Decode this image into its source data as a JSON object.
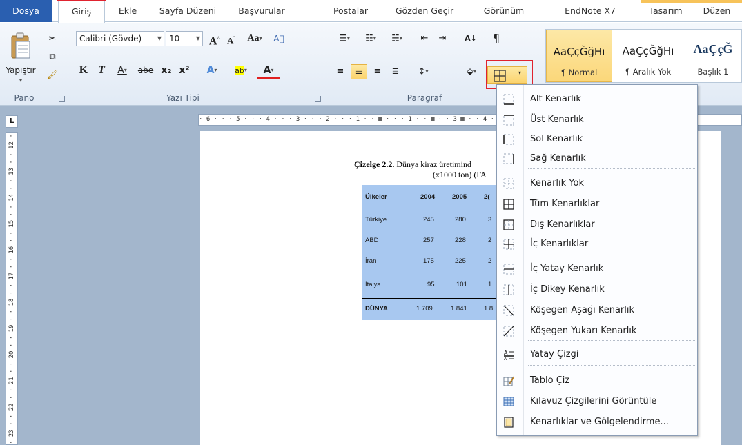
{
  "tabs": [
    {
      "id": "file",
      "label": "Dosya"
    },
    {
      "id": "home",
      "label": "Giriş"
    },
    {
      "id": "insert",
      "label": "Ekle"
    },
    {
      "id": "page-layout",
      "label": "Sayfa Düzeni"
    },
    {
      "id": "references",
      "label": "Başvurular"
    },
    {
      "id": "mailings",
      "label": "Postalar"
    },
    {
      "id": "review",
      "label": "Gözden Geçir"
    },
    {
      "id": "view",
      "label": "Görünüm"
    },
    {
      "id": "endnote",
      "label": "EndNote X7"
    },
    {
      "id": "design",
      "label": "Tasarım"
    },
    {
      "id": "layout",
      "label": "Düzen"
    }
  ],
  "ribbon": {
    "clipboard": {
      "paste": "Yapıştır",
      "label": "Pano"
    },
    "font": {
      "label": "Yazı Tipi",
      "family": "Calibri (Gövde)",
      "size": "10",
      "bold": "K",
      "italic": "T",
      "underline": "A",
      "strike": "abe",
      "sub": "x₂",
      "sup": "x²",
      "grow": "A",
      "shrink": "A",
      "case": "Aa",
      "color": "A"
    },
    "paragraph": {
      "label": "Paragraf",
      "pilcrow": "¶",
      "sort": "A↓"
    },
    "styles": {
      "items": [
        {
          "sample": "AaÇçĞğHı",
          "name": "¶ Normal"
        },
        {
          "sample": "AaÇçĞğHı",
          "name": "¶ Aralık Yok"
        },
        {
          "sample": "AaÇçĞ",
          "name": "Başlık 1"
        }
      ]
    }
  },
  "rulers": {
    "corner": "L",
    "horizontal": "· 6 · · · 5 · · · 4 · · · 3 · · · 2 · · · 1 · · ▦ · · · 1 · · ▦ · · 3 ▦ · · 4 · ▦ 5                                                   · 14 ·",
    "vertical": "· 23 · · 22 · · 21 · · 20 · · 19 · · 18 · · 17 · · 16 · · 15 · · 14 · · 13 · · 12 ·"
  },
  "document": {
    "caption_bold": "Çizelge 2.2.",
    "caption_text": " Dünya kiraz üretimind",
    "caption_line2": "(x1000 ton) (FA",
    "table": {
      "header": [
        "Ülkeler",
        "2004",
        "2005",
        "2("
      ],
      "rows": [
        [
          "Türkiye",
          "245",
          "280",
          "3"
        ],
        [
          "ABD",
          "257",
          "228",
          "2"
        ],
        [
          "İran",
          "175",
          "225",
          "2"
        ],
        [
          "İtalya",
          "95",
          "101",
          "1"
        ]
      ],
      "total": [
        "DÜNYA",
        "1 709",
        "1 841",
        "1 8"
      ]
    }
  },
  "border_menu": {
    "items": [
      {
        "label": "Alt Kenarlık",
        "icon": "border-bottom-icon"
      },
      {
        "label": "Üst Kenarlık",
        "icon": "border-top-icon"
      },
      {
        "label": "Sol Kenarlık",
        "icon": "border-left-icon"
      },
      {
        "label": "Sağ Kenarlık",
        "icon": "border-right-icon"
      },
      {
        "label": "Kenarlık Yok",
        "icon": "border-none-icon"
      },
      {
        "label": "Tüm Kenarlıklar",
        "icon": "border-all-icon"
      },
      {
        "label": "Dış Kenarlıklar",
        "icon": "border-outside-icon"
      },
      {
        "label": "İç Kenarlıklar",
        "icon": "border-inside-icon"
      },
      {
        "label": "İç Yatay Kenarlık",
        "icon": "border-inside-horizontal-icon"
      },
      {
        "label": "İç Dikey Kenarlık",
        "icon": "border-inside-vertical-icon"
      },
      {
        "label": "Köşegen Aşağı Kenarlık",
        "icon": "border-diagonal-down-icon"
      },
      {
        "label": "Köşegen Yukarı Kenarlık",
        "icon": "border-diagonal-up-icon"
      },
      {
        "label": "Yatay Çizgi",
        "icon": "horizontal-line-icon"
      },
      {
        "label": "Tablo Çiz",
        "icon": "draw-table-icon"
      },
      {
        "label": "Kılavuz Çizgilerini Görüntüle",
        "icon": "view-gridlines-icon"
      },
      {
        "label": "Kenarlıklar ve Gölgelendirme...",
        "icon": "borders-shading-icon"
      }
    ]
  }
}
